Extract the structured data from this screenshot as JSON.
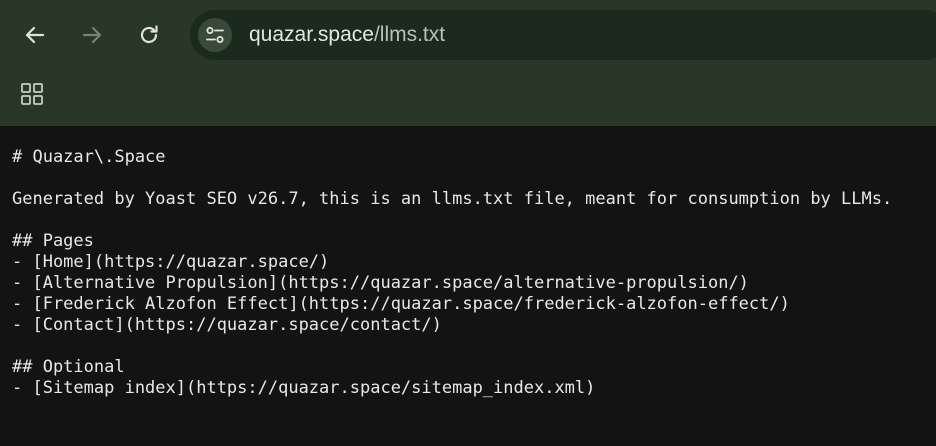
{
  "toolbar": {
    "url_domain": "quazar.space",
    "url_path": "/llms.txt"
  },
  "document": {
    "lines": [
      "# Quazar\\.Space",
      "",
      "Generated by Yoast SEO v26.7, this is an llms.txt file, meant for consumption by LLMs.",
      "",
      "## Pages",
      "- [Home](https://quazar.space/)",
      "- [Alternative Propulsion](https://quazar.space/alternative-propulsion/)",
      "- [Frederick Alzofon Effect](https://quazar.space/frederick-alzofon-effect/)",
      "- [Contact](https://quazar.space/contact/)",
      "",
      "## Optional",
      "- [Sitemap index](https://quazar.space/sitemap_index.xml)"
    ]
  },
  "colors": {
    "chrome_background": "#283727",
    "omnibox_background": "#1b2a1c",
    "page_background": "#131313",
    "text": "#e8e8e8"
  },
  "icons": {
    "back": "arrow-left-icon",
    "forward": "arrow-right-icon",
    "reload": "reload-icon",
    "site_info": "tune-icon",
    "apps": "apps-grid-icon"
  }
}
